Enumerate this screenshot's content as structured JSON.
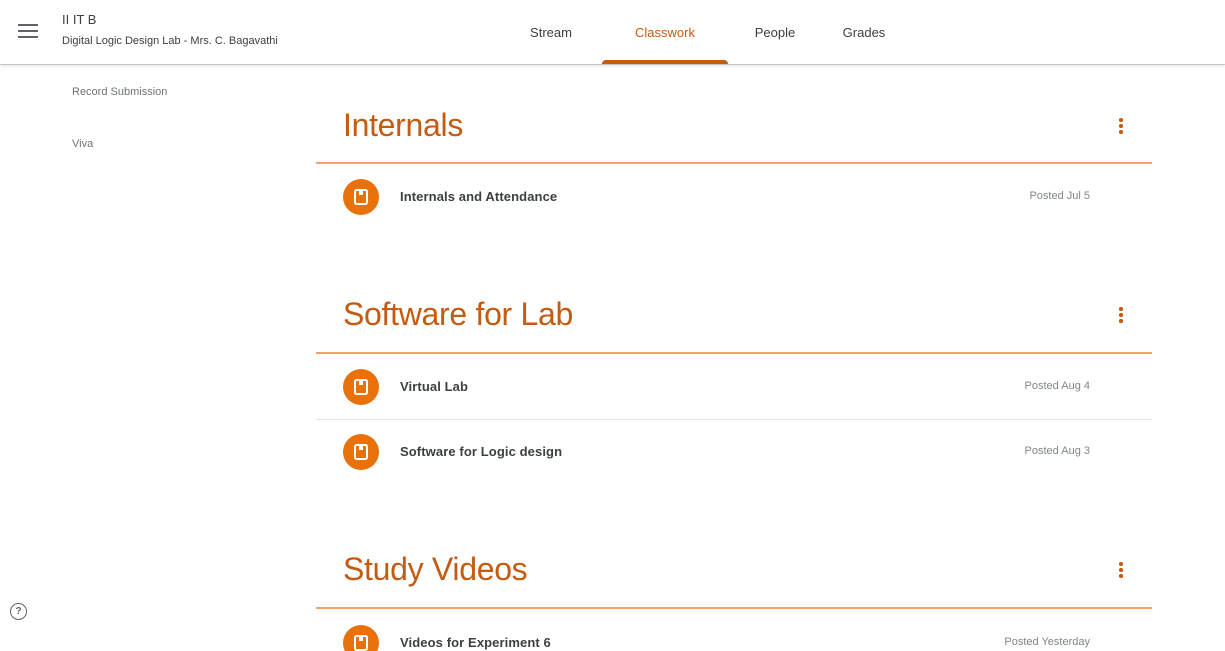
{
  "header": {
    "class_name": "II IT B",
    "class_subtitle": "Digital Logic Design Lab - Mrs. C. Bagavathi",
    "menu_icon": "hamburger-menu-icon",
    "tabs": [
      {
        "label": "Stream",
        "active": false
      },
      {
        "label": "Classwork",
        "active": true
      },
      {
        "label": "People",
        "active": false
      },
      {
        "label": "Grades",
        "active": false
      }
    ]
  },
  "sidebar": {
    "topics": [
      {
        "label": "Record Submission"
      },
      {
        "label": "Viva"
      }
    ],
    "help_icon": "help-icon",
    "help_glyph": "?"
  },
  "sections": [
    {
      "title": "Internals",
      "items": [
        {
          "title": "Internals and Attendance",
          "date": "Posted Jul 5",
          "icon": "material-icon"
        }
      ]
    },
    {
      "title": "Software for Lab",
      "items": [
        {
          "title": "Virtual Lab",
          "date": "Posted Aug 4",
          "icon": "material-icon"
        },
        {
          "title": "Software for Logic design",
          "date": "Posted Aug 3",
          "icon": "material-icon"
        }
      ]
    },
    {
      "title": "Study Videos",
      "items": [
        {
          "title": "Videos for Experiment 6",
          "date": "Posted Yesterday",
          "icon": "material-icon"
        }
      ]
    }
  ],
  "colors": {
    "accent": "#c55a11",
    "icon_bg": "#e8710a",
    "rule": "#f0a46c"
  }
}
